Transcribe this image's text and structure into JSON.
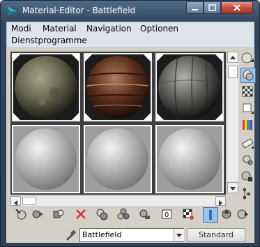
{
  "window": {
    "title": "Material-Editor - Battlefield"
  },
  "menu": {
    "items": [
      "Modi",
      "Material",
      "Navigation",
      "Optionen",
      "Dienstprogramme"
    ]
  },
  "slots": [
    {
      "kind": "rock"
    },
    {
      "kind": "wood"
    },
    {
      "kind": "stone"
    },
    {
      "kind": "default"
    },
    {
      "kind": "default"
    },
    {
      "kind": "default"
    }
  ],
  "side_tools": [
    "sample-type-icon",
    "backlight-icon",
    "background-checker-icon",
    "sample-uv-tiling-icon",
    "video-color-check-icon",
    "make-preview-icon",
    "options-icon",
    "select-by-material-icon",
    "material-map-navigator-icon"
  ],
  "bottom_tools": [
    "get-material-icon",
    "put-to-scene-icon",
    "assign-material-icon",
    "reset-map-icon",
    "copy-material-icon",
    "make-unique-icon",
    "put-to-library-icon",
    "material-id-channel-icon",
    "show-in-viewport-icon",
    "show-end-result-icon",
    "go-to-parent-icon",
    "go-forward-sibling-icon"
  ],
  "material": {
    "name": "Battlefield",
    "type_label": "Standard"
  },
  "colors": {
    "titlebar": "#3a5570",
    "menubar": "#dde4ec",
    "panel": "#d4d0c8",
    "close_red": "#c44b3b",
    "active_tool": "#9ec1e8"
  }
}
